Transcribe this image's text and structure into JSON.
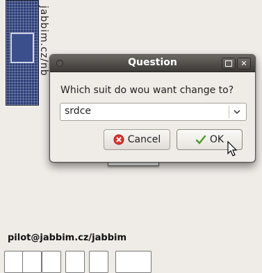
{
  "background": {
    "vertical_text": "jabbim.cz/nb"
  },
  "dialog": {
    "title": "Question",
    "question": "Which suit do wou want change to?",
    "combo_value": "srdce",
    "cancel_label": "Cancel",
    "ok_label": "OK",
    "icons": {
      "cancel": "cancel-icon",
      "ok": "checkmark-icon",
      "maximize": "maximize-icon",
      "close": "close-icon"
    }
  },
  "footer": {
    "username": "pilot@jabbim.cz/jabbim"
  },
  "colors": {
    "titlebar": "#3c3a37",
    "card_back": "#2c3f78",
    "cancel_red": "#d9372f",
    "ok_green": "#4c9a2a"
  }
}
